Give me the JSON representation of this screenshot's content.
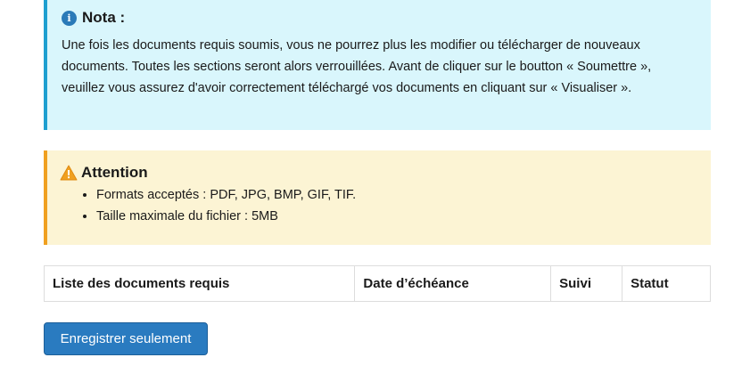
{
  "nota": {
    "title": "Nota :",
    "icon": "info-icon",
    "text": "Une fois les documents requis soumis, vous ne pourrez plus les modifier ou télécharger de nouveaux documents. Toutes les sections seront alors verrouillées. Avant de cliquer sur le boutton « Soumettre », veuillez vous assurez d'avoir correctement téléchargé vos documents en cliquant sur « Visualiser »."
  },
  "attention": {
    "title": "Attention",
    "icon": "warning-icon",
    "items": [
      "Formats acceptés : PDF, JPG, BMP, GIF, TIF.",
      "Taille maximale du fichier : 5MB"
    ]
  },
  "table": {
    "headers": [
      "Liste des documents requis",
      "Date d’échéance",
      "Suivi",
      "Statut"
    ]
  },
  "actions": {
    "save_label": "Enregistrer seulement"
  },
  "colors": {
    "nota_bg": "#d9f6fc",
    "nota_border": "#1e9fd0",
    "attention_bg": "#fcf4d4",
    "attention_border": "#f0a020",
    "button": "#2a7bc0"
  }
}
